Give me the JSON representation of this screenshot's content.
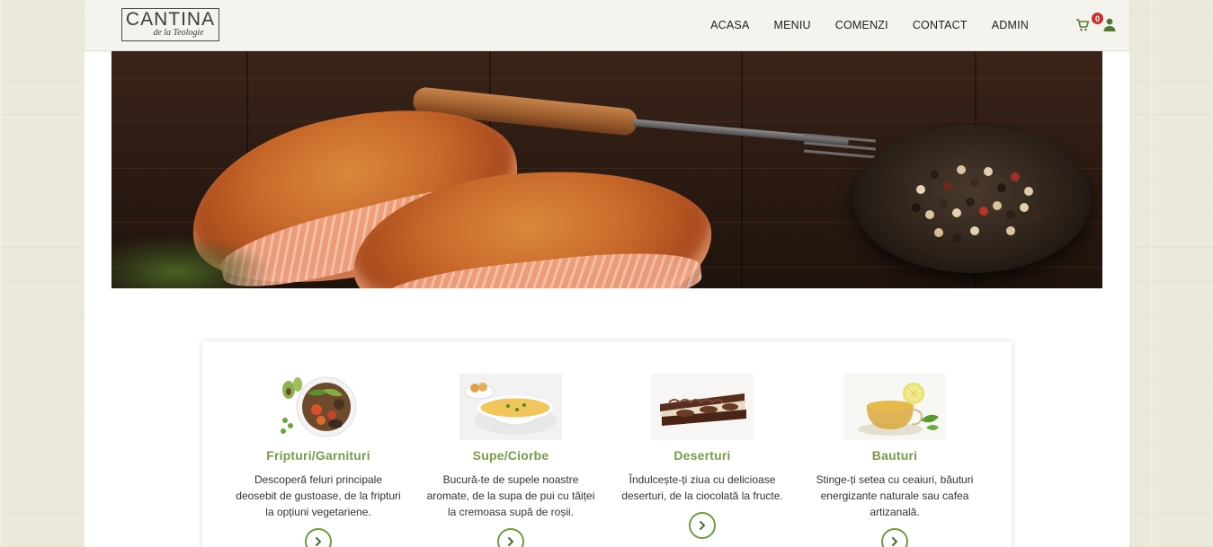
{
  "brand": {
    "name": "CANTINA",
    "tagline": "de la Teologie"
  },
  "nav": {
    "items": [
      {
        "label": "ACASA"
      },
      {
        "label": "MENIU"
      },
      {
        "label": "COMENZI"
      },
      {
        "label": "CONTACT"
      },
      {
        "label": "ADMIN"
      }
    ],
    "cart_count": "0",
    "cart_icon": "cart-icon",
    "user_icon": "user-icon"
  },
  "colors": {
    "accent_green": "#6e9a3e",
    "title_green": "#7a9a4a",
    "badge_red": "#c9302c"
  },
  "categories": [
    {
      "title": "Fripturi/Garnituri",
      "desc": "Descoperă feluri principale deosebit de gustoase, de la fripturi la opțiuni vegetariene.",
      "icon": "main-dish-plate-image"
    },
    {
      "title": "Supe/Ciorbe",
      "desc": "Bucură-te de supele noastre aromate, de la supa de pui cu tăiței la cremoasa supă de roșii.",
      "icon": "soup-bowl-image"
    },
    {
      "title": "Deserturi",
      "desc": "Îndulcește-ți ziua cu delicioase deserturi, de la ciocolată la fructe.",
      "icon": "cake-slice-image"
    },
    {
      "title": "Bauturi",
      "desc": "Stinge-ți setea cu ceaiuri, băuturi energizante naturale sau cafea artizanală.",
      "icon": "tea-cup-image"
    }
  ]
}
